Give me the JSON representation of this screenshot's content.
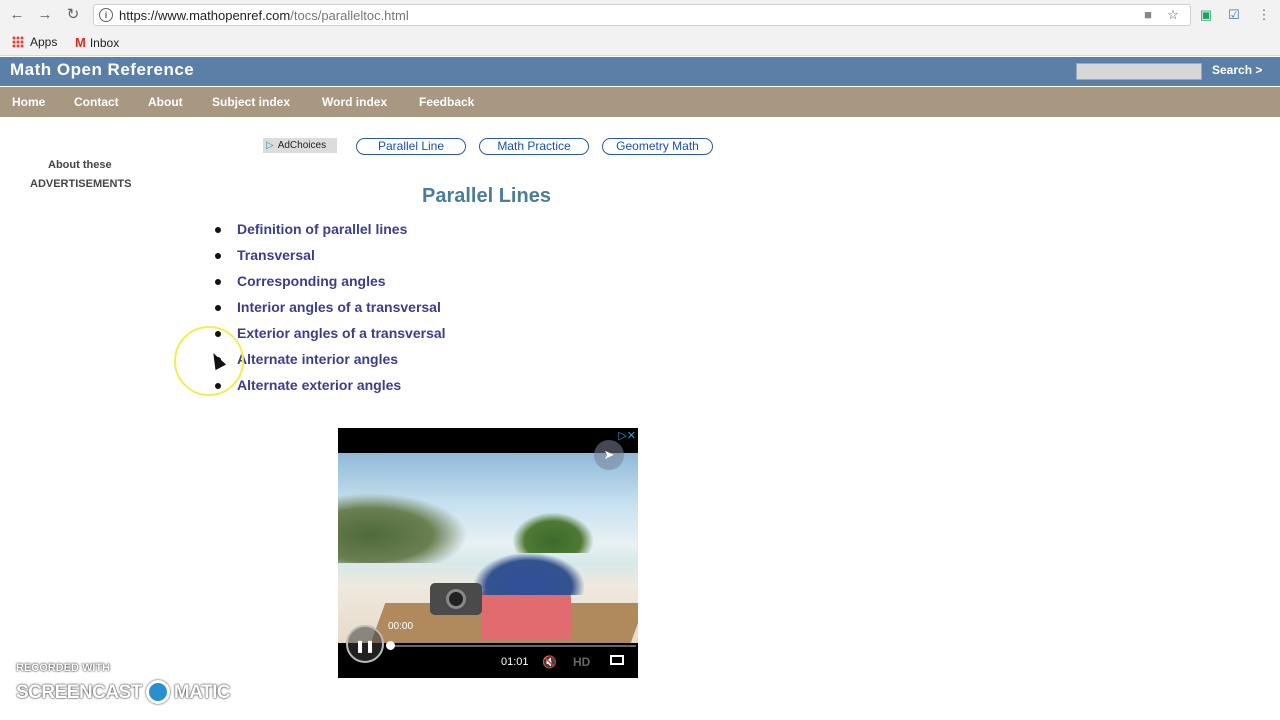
{
  "browser": {
    "url_host": "https://www.mathopenref.com",
    "url_path": "/tocs/paralleltoc.html",
    "bookmarks": [
      {
        "label": "Apps",
        "icon": "apps-grid-icon"
      },
      {
        "label": "Inbox",
        "icon": "gmail-icon"
      }
    ]
  },
  "site": {
    "title": "Math Open Reference",
    "search_label": "Search >",
    "nav": [
      "Home",
      "Contact",
      "About",
      "Subject index",
      "Word index",
      "Feedback"
    ]
  },
  "sidebar": {
    "about": "About these",
    "ads": "ADVERTISEMENTS"
  },
  "ads": {
    "adchoices": "AdChoices",
    "links": [
      "Parallel Line",
      "Math Practice",
      "Geometry Math"
    ]
  },
  "main": {
    "title": "Parallel Lines",
    "toc": [
      "Definition of parallel lines",
      "Transversal",
      "Corresponding angles",
      "Interior angles of a transversal",
      "Exterior angles of a transversal",
      "Alternate interior angles",
      "Alternate exterior angles"
    ]
  },
  "video": {
    "time_current": "00:00",
    "time_total": "01:01",
    "hd_label": "HD",
    "progress": 0.0
  },
  "watermark": {
    "line1": "RECORDED WITH",
    "left": "SCREENCAST",
    "right": "MATIC"
  }
}
